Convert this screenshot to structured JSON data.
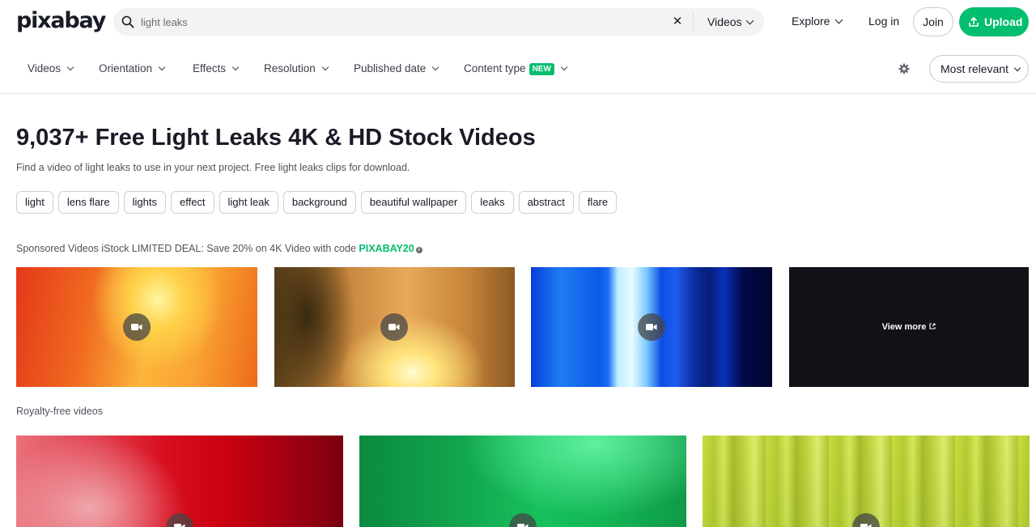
{
  "header": {
    "logo": "pixabay",
    "search": {
      "value": "",
      "placeholder": "light leaks"
    },
    "scope_label": "Videos",
    "explore_label": "Explore",
    "login_label": "Log in",
    "join_label": "Join",
    "upload_label": "Upload"
  },
  "filters": {
    "items": [
      {
        "label": "Videos"
      },
      {
        "label": "Orientation"
      },
      {
        "label": "Effects"
      },
      {
        "label": "Resolution"
      },
      {
        "label": "Published date"
      },
      {
        "label": "Content type",
        "badge": "NEW"
      }
    ],
    "sort_label": "Most relevant"
  },
  "main": {
    "title": "9,037+ Free Light Leaks 4K & HD Stock Videos",
    "subtitle": "Find a video of light leaks to use in your next project. Free light leaks clips for download.",
    "tags": [
      "light",
      "lens flare",
      "lights",
      "effect",
      "light leak",
      "background",
      "beautiful wallpaper",
      "leaks",
      "abstract",
      "flare"
    ],
    "sponsored_text": "Sponsored Videos iStock LIMITED DEAL: Save 20% on 4K Video with code ",
    "sponsored_code": "PIXABAY20",
    "view_more_label": "View more",
    "royalty_label": "Royalty-free videos"
  },
  "colors": {
    "accent": "#02be6e",
    "text": "#191b26"
  },
  "icons": [
    "search-icon",
    "close-icon",
    "chevron-down-icon",
    "upload-icon",
    "gear-icon",
    "info-icon",
    "video-camera-icon",
    "external-link-icon"
  ]
}
